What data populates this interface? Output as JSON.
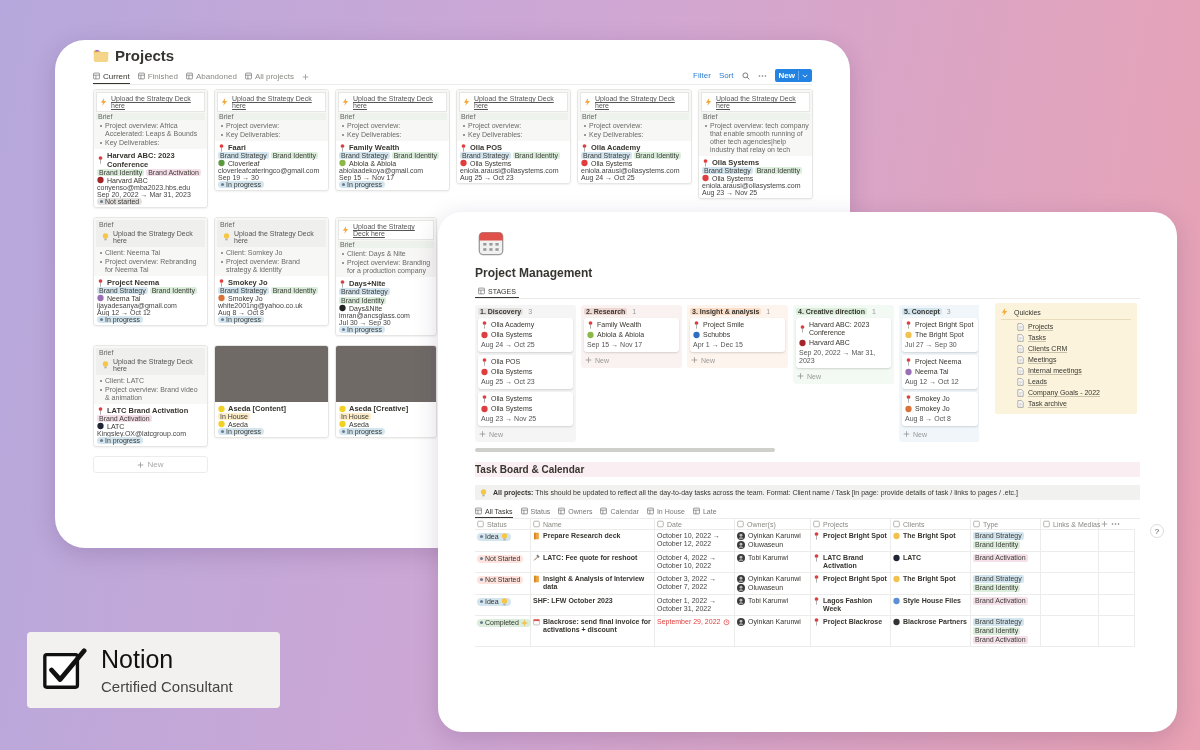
{
  "projects_window": {
    "title": "Projects",
    "views": [
      {
        "label": "Current",
        "selected": true
      },
      {
        "label": "Finished",
        "selected": false
      },
      {
        "label": "Abandoned",
        "selected": false
      },
      {
        "label": "All projects",
        "selected": false
      }
    ],
    "filter": "Filter",
    "sort": "Sort",
    "new_button": "New",
    "cards": [
      {
        "kind": "deck_top",
        "deck": "Upload the Strategy Deck here",
        "brief": "Brief",
        "bullets": [
          "Project overview: Africa Accelerated: Leaps & Bounds",
          "Key Deliverables:"
        ],
        "title": "Harvard ABC: 2023 Conference",
        "tags": [
          {
            "label": "Brand Identity",
            "color": "#dbeddb"
          },
          {
            "label": "Brand Activation",
            "color": "#f5e0e9"
          }
        ],
        "client": {
          "name": "Harvard ABC",
          "color": "#a3262a"
        },
        "email": "conyenso@mba2023.hbs.edu",
        "dates": "Sep 20, 2022 → Mar 31, 2023",
        "status": {
          "label": "Not started",
          "color": "#e3e2e0"
        }
      },
      {
        "kind": "deck_top",
        "deck": "Upload the Strategy Deck here",
        "brief": "Brief",
        "bullets": [
          "Project overview:",
          "Key Deliverables:"
        ],
        "title": "Faari",
        "tags": [
          {
            "label": "Brand Strategy",
            "color": "#d3e5ef"
          },
          {
            "label": "Brand Identity",
            "color": "#dbeddb"
          }
        ],
        "client": {
          "name": "Cloverleaf",
          "color": "#5a9a3c"
        },
        "email": "cloverleafcateringco@gmail.com",
        "dates": "Sep 19 → 30",
        "status": {
          "label": "In progress",
          "color": "#d3e5ef"
        }
      },
      {
        "kind": "deck_top",
        "deck": "Upload the Strategy Deck here",
        "brief": "Brief",
        "bullets": [
          "Project overview:",
          "Key Deliverables:"
        ],
        "title": "Family Wealth",
        "tags": [
          {
            "label": "Brand Strategy",
            "color": "#d3e5ef"
          },
          {
            "label": "Brand Identity",
            "color": "#dbeddb"
          }
        ],
        "client": {
          "name": "Abiola & Abiola",
          "color": "#8cb84a"
        },
        "email": "abiolaadekoya@gmail.com",
        "dates": "Sep 15 → Nov 17",
        "status": {
          "label": "In progress",
          "color": "#d3e5ef"
        }
      },
      {
        "kind": "deck_top",
        "deck": "Upload the Strategy Deck here",
        "brief": "Brief",
        "bullets": [
          "Project overview:",
          "Key Deliverables:"
        ],
        "title": "Olla POS",
        "tags": [
          {
            "label": "Brand Strategy",
            "color": "#d3e5ef"
          },
          {
            "label": "Brand Identity",
            "color": "#dbeddb"
          }
        ],
        "client": {
          "name": "Olla Systems",
          "color": "#e03e3e"
        },
        "email": "eniola.arausi@ollasystems.com",
        "dates": "Aug 25 → Oct 23"
      },
      {
        "kind": "deck_top",
        "deck": "Upload the Strategy Deck here",
        "brief": "Brief",
        "bullets": [
          "Project overview:",
          "Key Deliverables:"
        ],
        "title": "Olla Academy",
        "tags": [
          {
            "label": "Brand Strategy",
            "color": "#d3e5ef"
          },
          {
            "label": "Brand Identity",
            "color": "#dbeddb"
          }
        ],
        "client": {
          "name": "Olla Systems",
          "color": "#e03e3e"
        },
        "email": "eniola.arausi@ollasystems.com",
        "dates": "Aug 24 → Oct 25"
      },
      {
        "kind": "deck_top",
        "deck": "Upload the Strategy Deck here",
        "brief": "Brief",
        "bullets": [
          "Project overview: tech company that enable smooth running of other tech agencies|help industry that relay on tech"
        ],
        "title": "Olla Systems",
        "tags": [
          {
            "label": "Brand Strategy",
            "color": "#d3e5ef"
          },
          {
            "label": "Brand Identity",
            "color": "#dbeddb"
          }
        ],
        "client": {
          "name": "Olla Systems",
          "color": "#e03e3e"
        },
        "email": "eniola.arausi@ollasystems.com",
        "dates": "Aug 23 → Nov 25"
      },
      {
        "kind": "callout",
        "deck": "Upload the Strategy Deck here",
        "brief": "Brief",
        "bullets": [
          "Client: Neema Tai",
          "Project overview: Rebranding for Neema Tai"
        ],
        "title": "Project Neema",
        "tags": [
          {
            "label": "Brand Strategy",
            "color": "#d3e5ef"
          },
          {
            "label": "Brand Identity",
            "color": "#dbeddb"
          }
        ],
        "client": {
          "name": "Neema Tai",
          "color": "#9b6fb5"
        },
        "email": "ijayadesanya@gmail.com",
        "dates": "Aug 12 → Oct 12",
        "status": {
          "label": "In progress",
          "color": "#d3e5ef"
        }
      },
      {
        "kind": "callout",
        "deck": "Upload the Strategy Deck here",
        "brief": "Brief",
        "bullets": [
          "Client: Somkey Jo",
          "Project overview: Brand strategy & identity"
        ],
        "title": "Smokey Jo",
        "tags": [
          {
            "label": "Brand Strategy",
            "color": "#d3e5ef"
          },
          {
            "label": "Brand Identity",
            "color": "#dbeddb"
          }
        ],
        "client": {
          "name": "Smokey Jo",
          "color": "#d9733a"
        },
        "email": "white2001ng@yahoo.co.uk",
        "dates": "Aug 8 → Oct 8",
        "status": {
          "label": "In progress",
          "color": "#d3e5ef"
        }
      },
      {
        "kind": "deck_top",
        "deck": "Upload the Strategy Deck here",
        "brief": "Brief",
        "bullets": [
          "Client: Days & Nite",
          "Project overview: Branding for a production company"
        ],
        "title": "Days+Nite",
        "tags": [
          {
            "label": "Brand Strategy",
            "color": "#d3e5ef"
          },
          {
            "label": "Brand Identity",
            "color": "#dbeddb"
          }
        ],
        "client": {
          "name": "Days&Nite",
          "color": "#222222"
        },
        "email": "imran@ancsglass.com",
        "dates": "Jul 30 → Sep 30",
        "status": {
          "label": "In progress",
          "color": "#d3e5ef"
        }
      },
      {
        "kind": "callout",
        "deck": "Upload the Strategy Deck here",
        "brief": "Brief",
        "bullets": [
          "Client: LATC",
          "Project overview: Brand video & animation"
        ],
        "title": "LATC Brand Activation",
        "tags": [
          {
            "label": "Brand Activation",
            "color": "#f5e0e9"
          }
        ],
        "client": {
          "name": "LATC",
          "color": "#1f2535"
        },
        "email": "Kingsley.OX@latcgroup.com",
        "status": {
          "label": "In progress",
          "color": "#d3e5ef"
        }
      },
      {
        "kind": "photo",
        "title": "Aseda [Content]",
        "tags": [
          {
            "label": "In House",
            "color": "#fdecc8"
          }
        ],
        "client": {
          "name": "Aseda",
          "color": "#f2d024"
        },
        "status": {
          "label": "In progress",
          "color": "#d3e5ef"
        }
      },
      {
        "kind": "photo",
        "title": "Aseda [Creative]",
        "tags": [
          {
            "label": "In House",
            "color": "#fdecc8"
          }
        ],
        "client": {
          "name": "Aseda",
          "color": "#f2d024"
        },
        "status": {
          "label": "In progress",
          "color": "#d3e5ef"
        }
      }
    ],
    "new_card": "New"
  },
  "management_window": {
    "title": "Project Management",
    "board_tab": "STAGES",
    "columns": [
      {
        "label": "1. Discovery",
        "count": "3",
        "color": "#e3e2e0",
        "cards": [
          {
            "title": "Olla Academy",
            "client": {
              "name": "Olla Systems",
              "color": "#e03e3e"
            },
            "dates": "Aug 24 → Oct 25"
          },
          {
            "title": "Olla POS",
            "client": {
              "name": "Olla Systems",
              "color": "#e03e3e"
            },
            "dates": "Aug 25 → Oct 23"
          },
          {
            "title": "Olla Systems",
            "client": {
              "name": "Olla Systems",
              "color": "#e03e3e"
            },
            "dates": "Aug 23 → Nov 25"
          }
        ],
        "new": "New"
      },
      {
        "label": "2. Research",
        "count": "1",
        "color": "#eed7d2",
        "cards": [
          {
            "title": "Family Wealth",
            "client": {
              "name": "Abiola & Abiola",
              "color": "#8cb84a"
            },
            "dates": "Sep 15 → Nov 17"
          }
        ],
        "new": "New"
      },
      {
        "label": "3. Insight & analysis",
        "count": "1",
        "color": "#fadec9",
        "cards": [
          {
            "title": "Project Smile",
            "client": {
              "name": "Schubbs",
              "color": "#2f6fbf"
            },
            "dates": "Apr 1 → Dec 15"
          }
        ],
        "new": "New"
      },
      {
        "label": "4. Creative direction",
        "count": "1",
        "color": "#dbeddb",
        "cards": [
          {
            "title": "Harvard ABC: 2023 Conference",
            "client": {
              "name": "Harvard ABC",
              "color": "#a3262a"
            },
            "dates": "Sep 20, 2022 → Mar 31, 2023"
          }
        ],
        "new": "New"
      },
      {
        "label": "5. Concept",
        "count": "3",
        "color": "#d3e5ef",
        "cards": [
          {
            "title": "Project Bright Spot",
            "client": {
              "name": "The Bright Spot",
              "color": "#f2c14e"
            },
            "dates": "Jul 27 → Sep 30"
          },
          {
            "title": "Project Neema",
            "client": {
              "name": "Neema Tai",
              "color": "#9b6fb5"
            },
            "dates": "Aug 12 → Oct 12"
          },
          {
            "title": "Smokey Jo",
            "client": {
              "name": "Smokey Jo",
              "color": "#d9733a"
            },
            "dates": "Aug 8 → Oct 8"
          }
        ],
        "new": "New"
      }
    ],
    "quickies": {
      "title": "Quickies",
      "items": [
        "Projects",
        "Tasks",
        "Clients CRM",
        "Meetings",
        "Internal meetings",
        "Leads",
        "Company Goals - 2022",
        "Task archive"
      ]
    },
    "task_section": {
      "title": "Task Board & Calendar",
      "callout": "**All projects:** This should be updated to reflect all the day-to-day tasks across the team. Format: Client name / Task [in page: provide details of task / links to pages / .etc.]",
      "views": [
        {
          "label": "All Tasks",
          "selected": true
        },
        {
          "label": "Status",
          "selected": false
        },
        {
          "label": "Owners",
          "selected": false
        },
        {
          "label": "Calendar",
          "selected": false
        },
        {
          "label": "In House",
          "selected": false
        },
        {
          "label": "Late",
          "selected": false
        }
      ],
      "columns": [
        "Status",
        "Name",
        "Date",
        "Owner(s)",
        "Projects",
        "Clients",
        "Type",
        "Links & Medias"
      ],
      "rows": [
        {
          "status": {
            "label": "Idea",
            "kind": "idea",
            "color": "#d3e5ef"
          },
          "name": {
            "text": "Prepare Research deck",
            "kind": "book"
          },
          "date": "October 10, 2022 → October 12, 2022",
          "overdue": false,
          "owners": [
            "Oyinkan Karunwi",
            "Oluwaseun"
          ],
          "project": "Project Bright Spot",
          "client": {
            "name": "The Bright Spot",
            "color": "#f2c14e"
          },
          "types": [
            {
              "label": "Brand Strategy",
              "color": "#d3e5ef"
            },
            {
              "label": "Brand Identity",
              "color": "#dbeddb"
            }
          ]
        },
        {
          "status": {
            "label": "Not Started",
            "kind": "plain",
            "color": "#ffe2dd"
          },
          "name": {
            "text": "LATC: Fee quote for reshoot",
            "kind": "tools"
          },
          "date": "October 4, 2022 → October 10, 2022",
          "overdue": false,
          "owners": [
            "Tobi Karunwi"
          ],
          "project": "LATC Brand Activation",
          "client": {
            "name": "LATC",
            "color": "#1f2535"
          },
          "types": [
            {
              "label": "Brand Activation",
              "color": "#f5e0e9"
            }
          ]
        },
        {
          "status": {
            "label": "Not Started",
            "kind": "plain",
            "color": "#ffe2dd"
          },
          "name": {
            "text": "Insight & Analysis of Interview data",
            "kind": "book"
          },
          "date": "October 3, 2022 → October 7, 2022",
          "overdue": false,
          "owners": [
            "Oyinkan Karunwi",
            "Oluwaseun"
          ],
          "project": "Project Bright Spot",
          "client": {
            "name": "The Bright Spot",
            "color": "#f2c14e"
          },
          "types": [
            {
              "label": "Brand Strategy",
              "color": "#d3e5ef"
            },
            {
              "label": "Brand Identity",
              "color": "#dbeddb"
            }
          ]
        },
        {
          "status": {
            "label": "Idea",
            "kind": "idea",
            "color": "#d3e5ef"
          },
          "name": {
            "text": "SHF: LFW October 2023",
            "kind": "none"
          },
          "date": "October 1, 2022 → October 31, 2022",
          "overdue": false,
          "owners": [
            "Tobi Karunwi"
          ],
          "project": "Lagos Fashion Week",
          "client": {
            "name": "Style House Files",
            "color": "#5b8fd6"
          },
          "types": [
            {
              "label": "Brand Activation",
              "color": "#f5e0e9"
            }
          ]
        },
        {
          "status": {
            "label": "Completed",
            "kind": "completed",
            "color": "#dbeddb"
          },
          "name": {
            "text": "Blackrose: send final invoice for activations + discount",
            "kind": "calendar"
          },
          "date": "September 29, 2022",
          "overdue": true,
          "owners": [
            "Oyinkan Karunwi"
          ],
          "project": "Project Blackrose",
          "client": {
            "name": "Blackrose Partners",
            "color": "#333333"
          },
          "types": [
            {
              "label": "Brand Strategy",
              "color": "#d3e5ef"
            },
            {
              "label": "Brand Identity",
              "color": "#dbeddb"
            },
            {
              "label": "Brand Activation",
              "color": "#f5e0e9"
            }
          ]
        }
      ]
    },
    "help": "?"
  },
  "badge": {
    "brand": "Notion",
    "subtitle": "Certified Consultant"
  }
}
